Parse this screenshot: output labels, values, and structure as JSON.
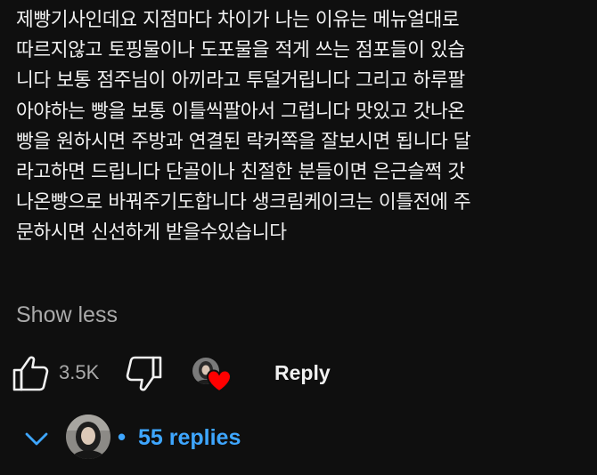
{
  "comment": {
    "lines": [
      "제빵기사인데요 지점마다 차이가 나는 이유는 메뉴얼대로",
      "따르지않고 토핑물이나 도포물을 적게 쓰는 점포들이 있습",
      "니다 보통 점주님이 아끼라고 투덜거립니다 그리고 하루팔",
      "아야하는 빵을 보통 이틀씩팔아서 그럽니다 맛있고 갓나온",
      "빵을 원하시면 주방과 연결된 락커쪽을 잘보시면 됩니다 달",
      "라고하면 드립니다 단골이나 친절한 분들이면 은근슬쩍 갓",
      "나온빵으로 바꿔주기도합니다 생크림케이크는 이틀전에 주",
      "문하시면 신선하게 받을수있습니다"
    ],
    "show_less_label": "Show less"
  },
  "actions": {
    "like_count": "3.5K",
    "reply_label": "Reply"
  },
  "replies": {
    "dot": "•",
    "count_label": "55 replies"
  },
  "colors": {
    "background": "#0f0f0f",
    "primary_text": "#f1f1f1",
    "secondary_text": "#aaaaaa",
    "link_blue": "#3ea6ff",
    "heart_red": "#ff0000"
  },
  "icons": {
    "like": "thumbs-up-icon",
    "dislike": "thumbs-down-icon",
    "heart": "heart-icon",
    "expand": "chevron-down-icon"
  }
}
